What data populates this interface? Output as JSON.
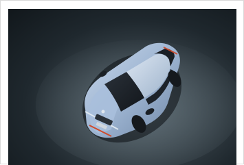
{
  "image": {
    "subject": "car-photo",
    "colors": {
      "body": "#9bb3cf",
      "body_light": "#c5d4e6",
      "glass": "#1a1f25",
      "backdrop": "#2b343a",
      "tail_accent": "#d04a2a"
    }
  }
}
